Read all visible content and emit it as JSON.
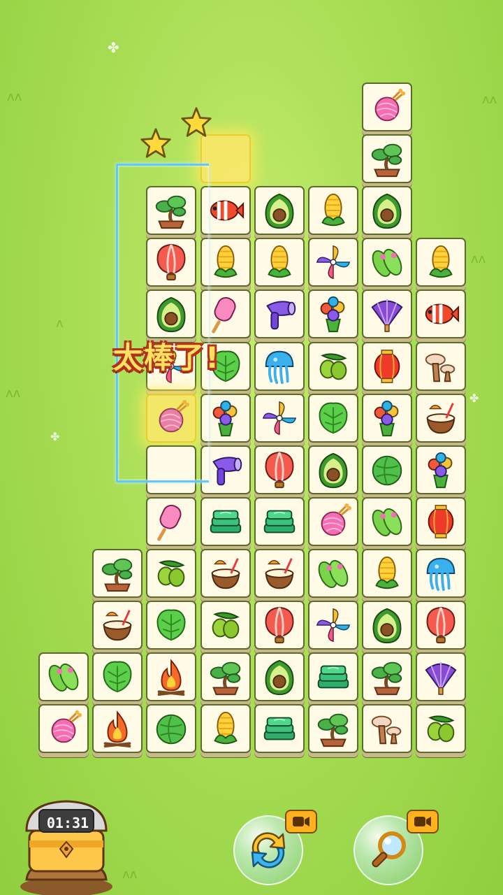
{
  "praise_text": "太棒了!",
  "timer": {
    "value": "01:31"
  },
  "buttons": {
    "shuffle_icon": "shuffle-arrows-icon",
    "hint_icon": "magnifier-icon",
    "ad_icon": "video-ad-icon"
  },
  "stars_earned": 2,
  "colors": {
    "background": "#a9de55",
    "tile_face": "#fffbe6",
    "path": "#5ec8ff",
    "highlight": "#ffe86a"
  },
  "selected_tiles": [
    {
      "col": 3,
      "row": 1
    },
    {
      "col": 2,
      "row": 6
    }
  ],
  "tiles": [
    {
      "col": 6,
      "row": 0,
      "item": "yarn"
    },
    {
      "col": 6,
      "row": 1,
      "item": "bonsai"
    },
    {
      "col": 3,
      "row": 1,
      "item": "cleared"
    },
    {
      "col": 2,
      "row": 2,
      "item": "bonsai"
    },
    {
      "col": 3,
      "row": 2,
      "item": "clownfish"
    },
    {
      "col": 4,
      "row": 2,
      "item": "avocado"
    },
    {
      "col": 5,
      "row": 2,
      "item": "corn"
    },
    {
      "col": 6,
      "row": 2,
      "item": "avocado"
    },
    {
      "col": 2,
      "row": 3,
      "item": "balloon"
    },
    {
      "col": 3,
      "row": 3,
      "item": "corn"
    },
    {
      "col": 4,
      "row": 3,
      "item": "corn"
    },
    {
      "col": 5,
      "row": 3,
      "item": "pinwheel"
    },
    {
      "col": 6,
      "row": 3,
      "item": "flipflops"
    },
    {
      "col": 7,
      "row": 3,
      "item": "corn"
    },
    {
      "col": 2,
      "row": 4,
      "item": "avocado"
    },
    {
      "col": 3,
      "row": 4,
      "item": "popsicle"
    },
    {
      "col": 4,
      "row": 4,
      "item": "hairdryer"
    },
    {
      "col": 5,
      "row": 4,
      "item": "bouquet"
    },
    {
      "col": 6,
      "row": 4,
      "item": "fan"
    },
    {
      "col": 7,
      "row": 4,
      "item": "clownfish"
    },
    {
      "col": 2,
      "row": 5,
      "item": "pinwheel"
    },
    {
      "col": 3,
      "row": 5,
      "item": "monstera"
    },
    {
      "col": 4,
      "row": 5,
      "item": "jellyfish"
    },
    {
      "col": 5,
      "row": 5,
      "item": "olives"
    },
    {
      "col": 6,
      "row": 5,
      "item": "lantern"
    },
    {
      "col": 7,
      "row": 5,
      "item": "mushroom"
    },
    {
      "col": 2,
      "row": 6,
      "item": "yarn"
    },
    {
      "col": 3,
      "row": 6,
      "item": "bouquet"
    },
    {
      "col": 4,
      "row": 6,
      "item": "pinwheel"
    },
    {
      "col": 5,
      "row": 6,
      "item": "monstera"
    },
    {
      "col": 6,
      "row": 6,
      "item": "bouquet"
    },
    {
      "col": 7,
      "row": 6,
      "item": "coconut"
    },
    {
      "col": 2,
      "row": 7,
      "item": "cleared"
    },
    {
      "col": 3,
      "row": 7,
      "item": "hairdryer"
    },
    {
      "col": 4,
      "row": 7,
      "item": "balloon"
    },
    {
      "col": 5,
      "row": 7,
      "item": "avocado"
    },
    {
      "col": 6,
      "row": 7,
      "item": "cabbage"
    },
    {
      "col": 7,
      "row": 7,
      "item": "bouquet"
    },
    {
      "col": 2,
      "row": 8,
      "item": "popsicle"
    },
    {
      "col": 3,
      "row": 8,
      "item": "towels"
    },
    {
      "col": 4,
      "row": 8,
      "item": "towels"
    },
    {
      "col": 5,
      "row": 8,
      "item": "yarn"
    },
    {
      "col": 6,
      "row": 8,
      "item": "flipflops"
    },
    {
      "col": 7,
      "row": 8,
      "item": "lantern"
    },
    {
      "col": 1,
      "row": 9,
      "item": "bonsai"
    },
    {
      "col": 2,
      "row": 9,
      "item": "olives"
    },
    {
      "col": 3,
      "row": 9,
      "item": "coconut"
    },
    {
      "col": 4,
      "row": 9,
      "item": "coconut"
    },
    {
      "col": 5,
      "row": 9,
      "item": "flipflops"
    },
    {
      "col": 6,
      "row": 9,
      "item": "corn"
    },
    {
      "col": 7,
      "row": 9,
      "item": "jellyfish"
    },
    {
      "col": 1,
      "row": 10,
      "item": "coconut"
    },
    {
      "col": 2,
      "row": 10,
      "item": "monstera"
    },
    {
      "col": 3,
      "row": 10,
      "item": "olives"
    },
    {
      "col": 4,
      "row": 10,
      "item": "balloon"
    },
    {
      "col": 5,
      "row": 10,
      "item": "pinwheel"
    },
    {
      "col": 6,
      "row": 10,
      "item": "avocado"
    },
    {
      "col": 7,
      "row": 10,
      "item": "balloon"
    },
    {
      "col": 0,
      "row": 11,
      "item": "flipflops"
    },
    {
      "col": 1,
      "row": 11,
      "item": "monstera"
    },
    {
      "col": 2,
      "row": 11,
      "item": "campfire"
    },
    {
      "col": 3,
      "row": 11,
      "item": "bonsai"
    },
    {
      "col": 4,
      "row": 11,
      "item": "avocado"
    },
    {
      "col": 5,
      "row": 11,
      "item": "towels"
    },
    {
      "col": 6,
      "row": 11,
      "item": "bonsai"
    },
    {
      "col": 7,
      "row": 11,
      "item": "fan"
    },
    {
      "col": 0,
      "row": 12,
      "item": "yarn"
    },
    {
      "col": 1,
      "row": 12,
      "item": "campfire"
    },
    {
      "col": 2,
      "row": 12,
      "item": "cabbage"
    },
    {
      "col": 3,
      "row": 12,
      "item": "corn"
    },
    {
      "col": 4,
      "row": 12,
      "item": "towels"
    },
    {
      "col": 5,
      "row": 12,
      "item": "bonsai"
    },
    {
      "col": 6,
      "row": 12,
      "item": "mushroom"
    },
    {
      "col": 7,
      "row": 12,
      "item": "olives"
    }
  ]
}
